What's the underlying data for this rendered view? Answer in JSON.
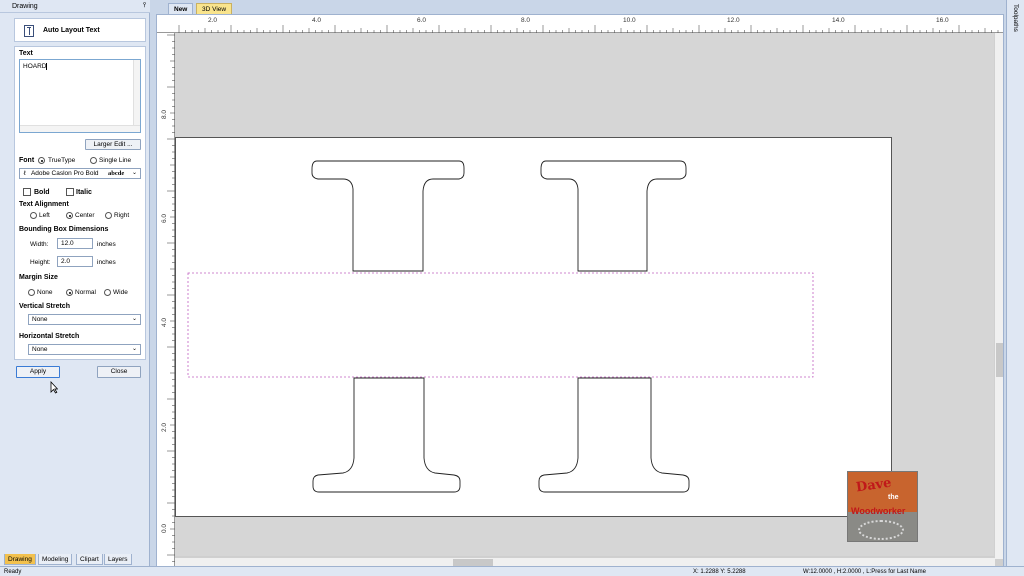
{
  "panel": {
    "title": "Drawing",
    "pin_glyph": "⫯",
    "tool_title": "Auto Layout Text",
    "text_section_label": "Text",
    "text_value": "HOARD",
    "larger_edit_label": "Larger Edit ...",
    "font_label": "Font",
    "font_truetype_label": "TrueType",
    "font_single_line_label": "Single Line",
    "font_name": "Adobe Caslon Pro Bold",
    "font_preview": "abcde",
    "bold_label": "Bold",
    "italic_label": "Italic",
    "alignment_label": "Text Alignment",
    "align_left": "Left",
    "align_center": "Center",
    "align_right": "Right",
    "bbox_label": "Bounding Box Dimensions",
    "width_label": "Width:",
    "width_value": "12.0",
    "height_label": "Height:",
    "height_value": "2.0",
    "units": "inches",
    "margin_label": "Margin Size",
    "margin_none": "None",
    "margin_normal": "Normal",
    "margin_wide": "Wide",
    "vstretch_label": "Vertical Stretch",
    "vstretch_value": "None",
    "hstretch_label": "Horizontal Stretch",
    "hstretch_value": "None",
    "apply_label": "Apply",
    "close_label": "Close"
  },
  "bottom_tabs": [
    {
      "label": "Drawing",
      "active": true
    },
    {
      "label": "Modeling"
    },
    {
      "label": "Clipart"
    },
    {
      "label": "Layers"
    }
  ],
  "doc_tabs": [
    {
      "label": "New",
      "active": true
    },
    {
      "label": "3D View"
    }
  ],
  "ruler_top_labels": [
    "2.0",
    "4.0",
    "6.0",
    "8.0",
    "10.0",
    "12.0",
    "14.0",
    "16.0"
  ],
  "ruler_left_labels": [
    "8.0",
    "6.0",
    "4.0",
    "2.0",
    "0.0"
  ],
  "right_strip_label": "Toolpaths",
  "status": {
    "ready": "Ready",
    "coords": "X: 1.2288 Y: 5.2288",
    "dims": "W:12.0000 , H:2.0000 , L:Press for Last Name"
  },
  "watermark": {
    "line1": "Dave",
    "line2": "the",
    "line3": "Woodworker"
  },
  "colors": {
    "selection": "#c060c0",
    "active_tab": "#f2c14e"
  }
}
